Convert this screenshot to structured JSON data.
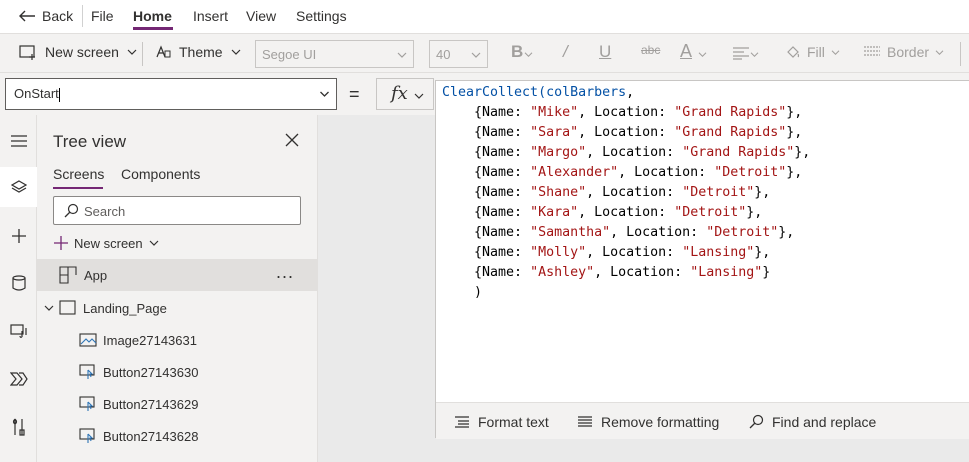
{
  "menu": {
    "back_label": "Back",
    "items": [
      "File",
      "Home",
      "Insert",
      "View",
      "Settings"
    ],
    "active": "Home"
  },
  "toolbar": {
    "new_screen_label": "New screen",
    "theme_label": "Theme",
    "font_family": "Segoe UI",
    "font_size": "40",
    "fill_label": "Fill",
    "border_label": "Border"
  },
  "formula_bar": {
    "property": "OnStart",
    "equals": "=",
    "fx_label": "fx"
  },
  "tree_view": {
    "title": "Tree view",
    "tabs": [
      "Screens",
      "Components"
    ],
    "active_tab": "Screens",
    "search_placeholder": "Search",
    "new_screen_label": "New screen",
    "app_label": "App",
    "more_label": "...",
    "screen_label": "Landing_Page",
    "children": [
      "Image27143631",
      "Button27143630",
      "Button27143629",
      "Button27143628"
    ]
  },
  "code": {
    "fn_name": "ClearCollect",
    "collection": "colBarbers",
    "records": [
      {
        "name": "\"Mike\"",
        "location": "\"Grand Rapids\""
      },
      {
        "name": "\"Sara\"",
        "location": "\"Grand Rapids\""
      },
      {
        "name": "\"Margo\"",
        "location": "\"Grand Rapids\""
      },
      {
        "name": "\"Alexander\"",
        "location": "\"Detroit\""
      },
      {
        "name": "\"Shane\"",
        "location": "\"Detroit\""
      },
      {
        "name": "\"Kara\"",
        "location": "\"Detroit\""
      },
      {
        "name": "\"Samantha\"",
        "location": "\"Detroit\""
      },
      {
        "name": "\"Molly\"",
        "location": "\"Lansing\""
      },
      {
        "name": "\"Ashley\"",
        "location": "\"Lansing\""
      }
    ],
    "closing": ")"
  },
  "editor_footer": {
    "format_text": "Format text",
    "remove_formatting": "Remove formatting",
    "find_replace": "Find and replace"
  },
  "colors": {
    "accent": "#742774",
    "function": "#0451a5",
    "string": "#a31515"
  }
}
